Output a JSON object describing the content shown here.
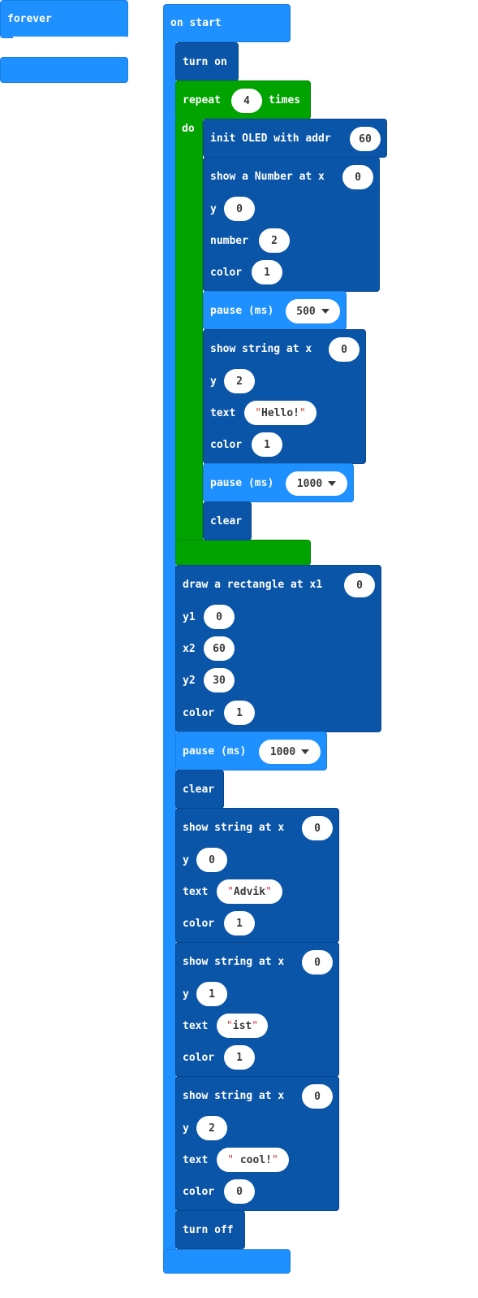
{
  "forever": {
    "label": "forever"
  },
  "on_start": {
    "label": "on start"
  },
  "turn_on": {
    "label": "turn on"
  },
  "repeat": {
    "label": "repeat",
    "count": "4",
    "times_label": "times",
    "do_label": "do"
  },
  "init_oled": {
    "label": "init OLED with addr",
    "addr": "60"
  },
  "show_number": {
    "label": "show a Number at x",
    "x": "0",
    "y_label": "y",
    "y": "0",
    "number_label": "number",
    "number": "2",
    "color_label": "color",
    "color": "1"
  },
  "pause_1": {
    "label": "pause (ms)",
    "value": "500"
  },
  "show_string_hello": {
    "label": "show string at x",
    "x": "0",
    "y_label": "y",
    "y": "2",
    "text_label": "text",
    "text": "Hello!",
    "color_label": "color",
    "color": "1"
  },
  "pause_2": {
    "label": "pause (ms)",
    "value": "1000"
  },
  "clear_1": {
    "label": "clear"
  },
  "rectangle": {
    "label": "draw a rectangle at x1",
    "x1": "0",
    "y1_label": "y1",
    "y1": "0",
    "x2_label": "x2",
    "x2": "60",
    "y2_label": "y2",
    "y2": "30",
    "color_label": "color",
    "color": "1"
  },
  "pause_3": {
    "label": "pause (ms)",
    "value": "1000"
  },
  "clear_2": {
    "label": "clear"
  },
  "show_string_advik": {
    "label": "show string at x",
    "x": "0",
    "y_label": "y",
    "y": "0",
    "text_label": "text",
    "text": "Advik",
    "color_label": "color",
    "color": "1"
  },
  "show_string_ist": {
    "label": "show string at x",
    "x": "0",
    "y_label": "y",
    "y": "1",
    "text_label": "text",
    "text": "ist",
    "color_label": "color",
    "color": "1"
  },
  "show_string_cool": {
    "label": "show string at x",
    "x": "0",
    "y_label": "y",
    "y": "2",
    "text_label": "text",
    "text": " cool!",
    "color_label": "color",
    "color": "0"
  },
  "turn_off": {
    "label": "turn off"
  },
  "colors": {
    "event_blue": "#1e90ff",
    "dark_blue": "#0b55a8",
    "loop_green": "#00a300",
    "string_quote": "#d9363e"
  },
  "quote_char": "\""
}
